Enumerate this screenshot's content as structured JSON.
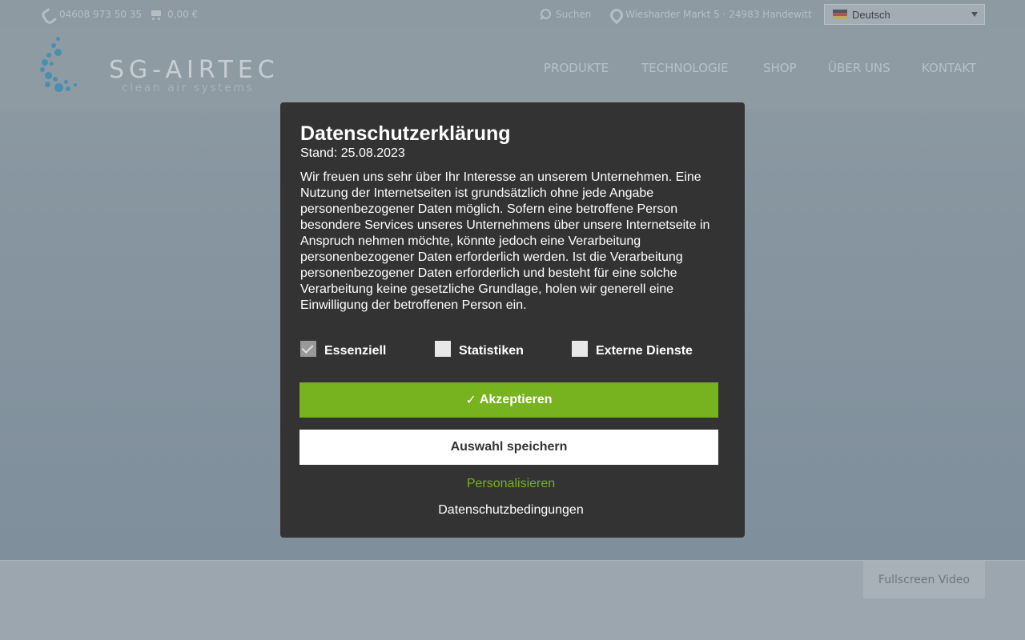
{
  "topbar": {
    "phone": "04608 973 50 35",
    "cart": "0,00 €",
    "search": "Suchen",
    "address": "Wiesharder Markt 5 · 24983 Handewitt",
    "language": "Deutsch"
  },
  "logo": {
    "title": "SG-AIRTEC",
    "subtitle": "clean air systems"
  },
  "nav": {
    "items": [
      "PRODUKTE",
      "TECHNOLOGIE",
      "SHOP",
      "ÜBER UNS",
      "KONTAKT"
    ]
  },
  "fullscreen_label": "Fullscreen Video",
  "modal": {
    "title": "Datenschutzerklärung",
    "date": "Stand: 25.08.2023",
    "body": "Wir freuen uns sehr über Ihr Interesse an unserem Unternehmen. Eine Nutzung der Internetseiten ist grundsätzlich ohne jede Angabe personenbezogener Daten möglich. Sofern eine betroffene Person besondere Services unseres Unternehmens über unsere Internetseite in Anspruch nehmen möchte, könnte jedoch eine Verarbeitung personenbezogener Daten erforderlich werden. Ist die Verarbeitung personenbezogener Daten erforderlich und besteht für eine solche Verarbeitung keine gesetzliche Grundlage, holen wir generell eine Einwilligung der betroffenen Person ein.",
    "checkboxes": [
      {
        "label": "Essenziell",
        "checked": true
      },
      {
        "label": "Statistiken",
        "checked": false
      },
      {
        "label": "Externe Dienste",
        "checked": false
      }
    ],
    "accept_tick": "✓",
    "accept_label": "Akzeptieren",
    "save_label": "Auswahl speichern",
    "personalize_label": "Personalisieren",
    "privacy_link_label": "Datenschutzbedingungen",
    "accent_color": "#76b31f",
    "background_color": "#333333"
  }
}
